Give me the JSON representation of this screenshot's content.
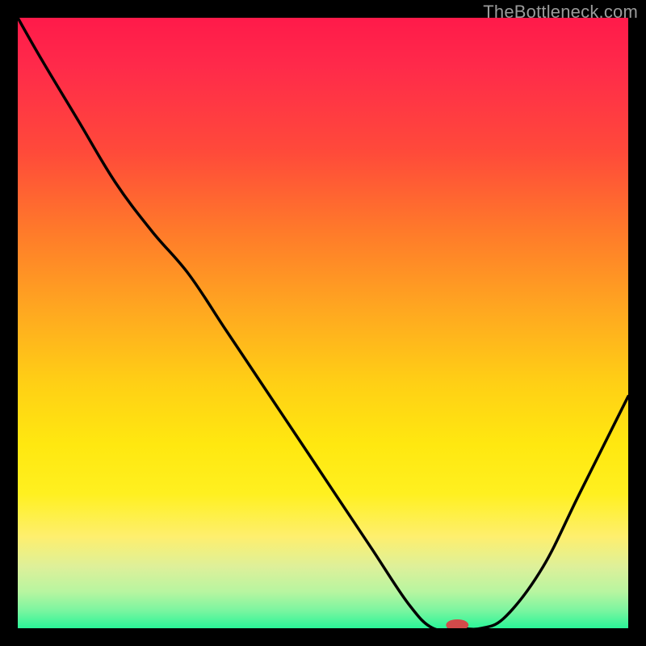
{
  "watermark": "TheBottleneck.com",
  "chart_data": {
    "type": "line",
    "title": "",
    "xlabel": "",
    "ylabel": "",
    "x": [
      0.0,
      0.04,
      0.1,
      0.16,
      0.22,
      0.28,
      0.34,
      0.4,
      0.46,
      0.52,
      0.58,
      0.64,
      0.68,
      0.72,
      0.76,
      0.8,
      0.86,
      0.92,
      1.0
    ],
    "y": [
      1.0,
      0.93,
      0.83,
      0.73,
      0.65,
      0.58,
      0.49,
      0.4,
      0.31,
      0.22,
      0.13,
      0.04,
      0.0,
      0.0,
      0.0,
      0.02,
      0.1,
      0.22,
      0.38
    ],
    "xlim": [
      0,
      1
    ],
    "ylim": [
      0,
      1
    ],
    "marker": {
      "x": 0.72,
      "y": 0.0
    }
  }
}
